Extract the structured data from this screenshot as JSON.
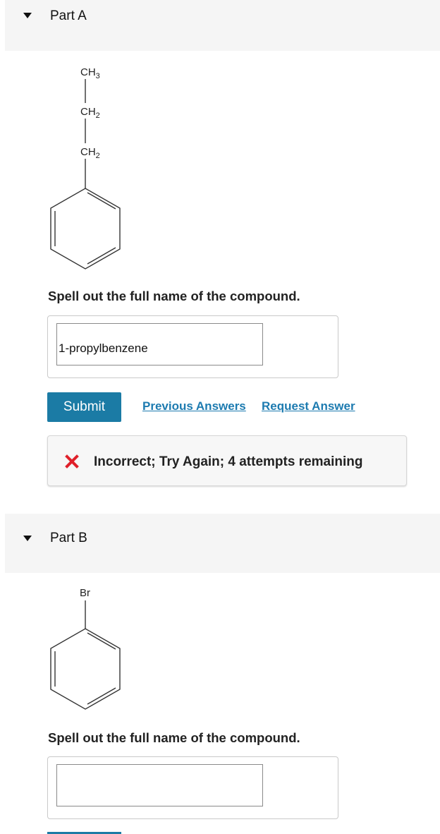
{
  "part_a": {
    "title": "Part A",
    "molecule_labels": {
      "ch3": "CH",
      "ch3_sub": "3",
      "ch2_top": "CH",
      "ch2_top_sub": "2",
      "ch2_bottom": "CH",
      "ch2_bottom_sub": "2"
    },
    "prompt": "Spell out the full name of the compound.",
    "answer_value": "1-propylbenzene",
    "submit_label": "Submit",
    "previous_answers_label": "Previous Answers",
    "request_answer_label": "Request Answer",
    "feedback_text": "Incorrect; Try Again; 4 attempts remaining",
    "feedback_icon": "x-icon",
    "feedback_color": "#e0202a"
  },
  "part_b": {
    "title": "Part B",
    "molecule_labels": {
      "br": "Br"
    },
    "prompt": "Spell out the full name of the compound.",
    "answer_value": ""
  },
  "colors": {
    "accent": "#1b7ba5",
    "link": "#1d7bb0",
    "header_bg": "#f5f5f5"
  }
}
